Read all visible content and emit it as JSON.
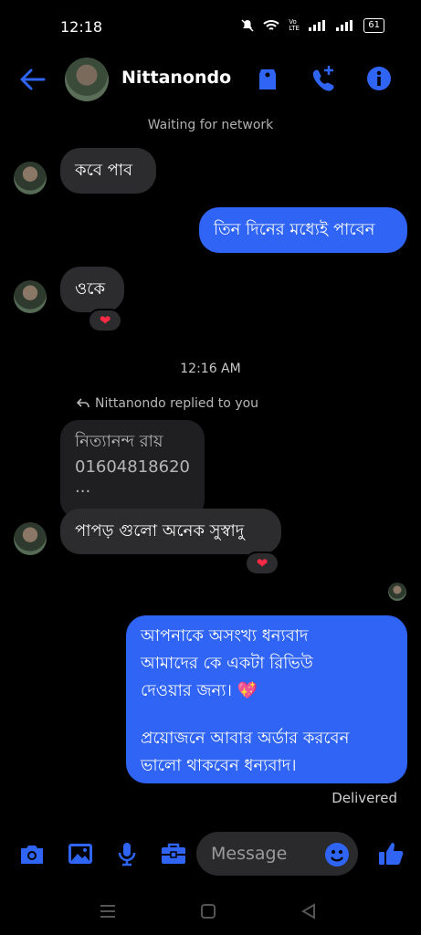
{
  "status_bar": {
    "time": "12:18",
    "battery": "61",
    "network_label": "Vo LTE"
  },
  "colors": {
    "accent": "#2f64f5",
    "incoming_bubble": "#2c2c2e",
    "heart": "#ff2b46"
  },
  "header": {
    "contact_name": "Nittanondo"
  },
  "network_status": "Waiting for network",
  "messages": {
    "m1_in": "কবে পাব",
    "m2_out": "তিন দিনের মধ্যেই পাবেন",
    "m3_in": "ওকে",
    "m3_reaction": "❤",
    "timestamp": "12:16 AM",
    "reply_note": "Nittanondo replied to you",
    "quoted_line1": "নিত্যানন্দ রায়",
    "quoted_line2": "01604818620",
    "quoted_line3": "...",
    "m4_in": "পাপড় গুলো অনেক সুস্বাদু",
    "m4_reaction": "❤",
    "m5_out_line1": "আপনাকে অসংখ্য ধন্যবাদ",
    "m5_out_line2": "আমাদের কে একটা রিভিউ",
    "m5_out_line3": "দেওয়ার জন্য। 💖",
    "m5_out_line4": "প্রয়োজনে আবার অর্ডার করবেন",
    "m5_out_line5": "ভালো থাকবেন ধন্যবাদ।",
    "delivered": "Delivered"
  },
  "composer": {
    "placeholder": "Message"
  },
  "icons": {
    "back": "arrow-left-icon",
    "tag": "tag-icon",
    "call": "add-call-icon",
    "info": "info-icon",
    "camera": "camera-icon",
    "gallery": "image-icon",
    "mic": "microphone-icon",
    "briefcase": "briefcase-icon",
    "emoji": "emoji-icon",
    "like": "thumbs-up-icon",
    "reply": "reply-arrow-icon"
  }
}
